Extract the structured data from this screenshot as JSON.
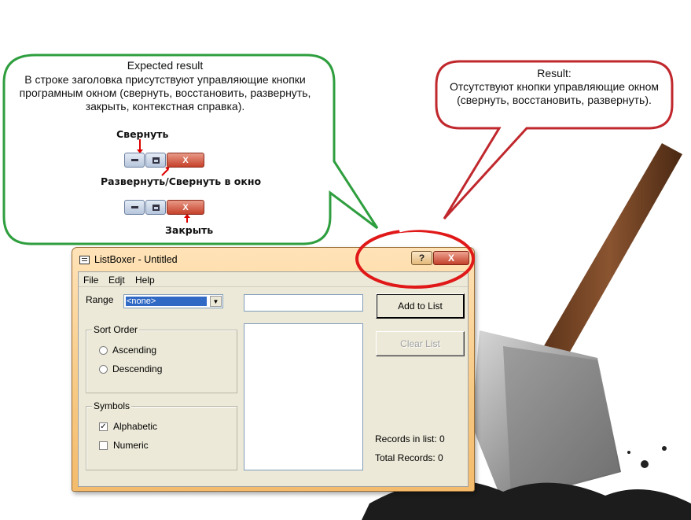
{
  "expected": {
    "title": "Expected result",
    "body": "В строке заголовка присутствуют управляющие кнопки програмным окном (свернуть, восстановить, развернуть, закрыть, контекстная справка).",
    "labels": {
      "minimize": "Свернуть",
      "maximize": "Развернуть/Свернуть в окно",
      "close": "Закрыть"
    },
    "close_glyph": "X"
  },
  "result": {
    "title": "Result:",
    "body": "Отсутствуют кнопки управляющие окном (свернуть, восстановить, развернуть)."
  },
  "window": {
    "title": "ListBoxer - Untitled",
    "help_glyph": "?",
    "close_glyph": "X",
    "menu": [
      "File",
      "Edjt",
      "Help"
    ],
    "range": {
      "label": "Range",
      "value": "<none>"
    },
    "sort_order": {
      "title": "Sort Order",
      "options": [
        "Ascending",
        "Descending"
      ]
    },
    "symbols": {
      "title": "Symbols",
      "options": [
        {
          "label": "Alphabetic",
          "checked": true
        },
        {
          "label": "Numeric",
          "checked": false
        }
      ]
    },
    "buttons": {
      "add": "Add to List",
      "clear": "Clear List"
    },
    "stats": {
      "records_in_list": "Records in list: 0",
      "total_records": "Total Records: 0"
    }
  },
  "colors": {
    "expected_border": "#2e9e3e",
    "result_border": "#c0282d",
    "highlight": "#e01818",
    "window_frame": "#f7c983"
  }
}
